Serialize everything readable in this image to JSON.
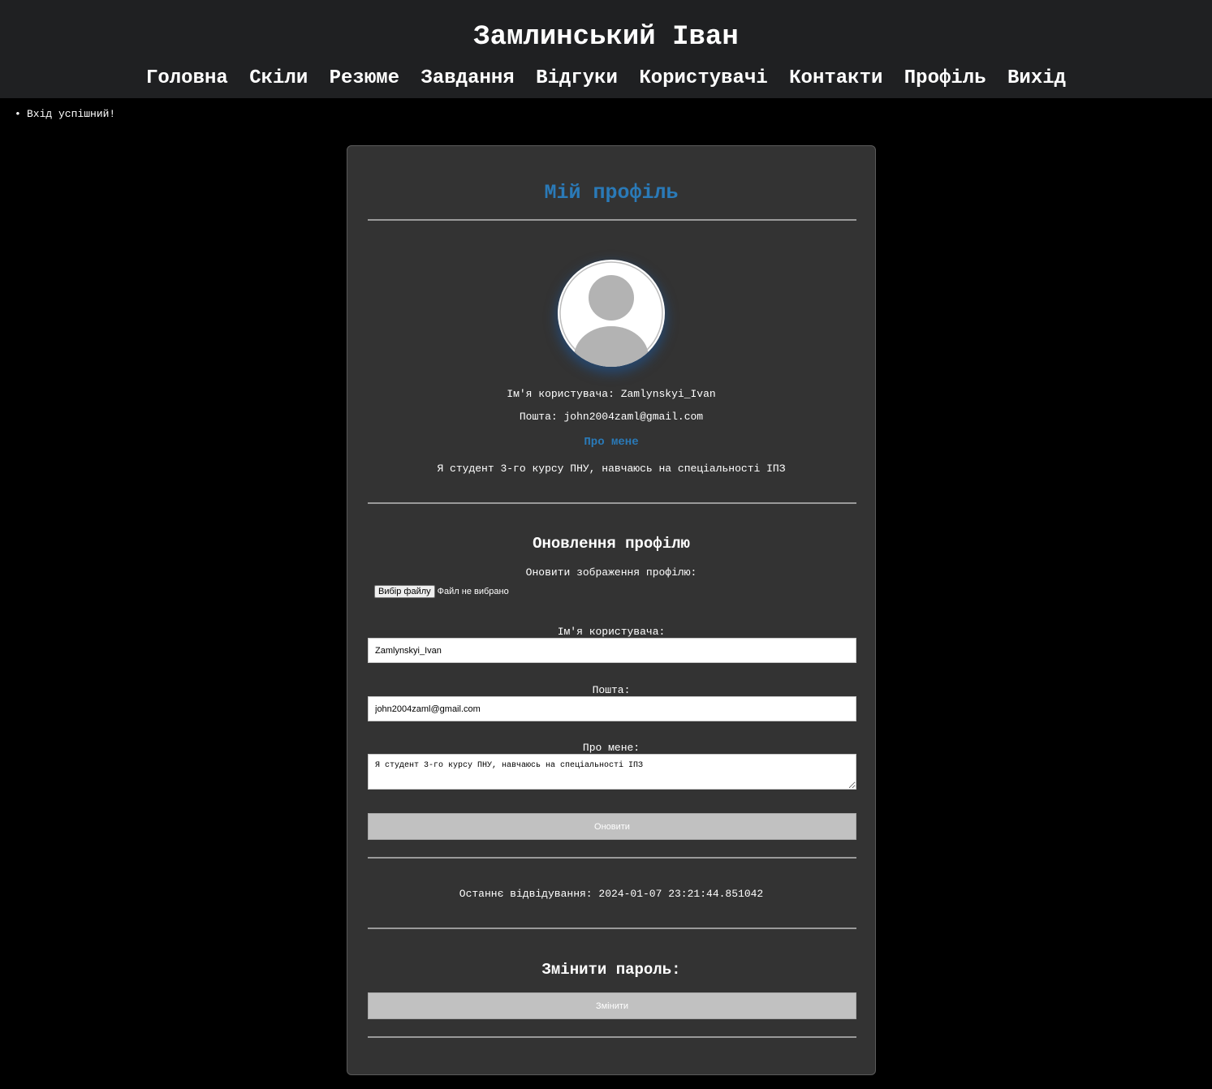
{
  "header": {
    "title": "Замлинський Іван",
    "nav": [
      "Головна",
      "Скіли",
      "Резюме",
      "Завдання",
      "Відгуки",
      "Користувачі",
      "Контакти",
      "Профіль",
      "Вихід"
    ]
  },
  "messages": [
    "Вхід успішний!"
  ],
  "profile": {
    "title": "Мій профіль",
    "avatar_icon": "default-user-avatar",
    "username_line": "Ім'я користувача: Zamlynskyi_Ivan",
    "email_line": "Пошта: john2004zaml@gmail.com",
    "about_heading": "Про мене",
    "about_text": "Я студент 3-го курсу ПНУ, навчаюсь на спеціальності ІПЗ"
  },
  "update_form": {
    "heading": "Оновлення профілю",
    "image_label": "Оновити зображення профілю:",
    "file_button": "Вибір файлу",
    "file_status": "Файл не вибрано",
    "username_label": "Ім'я користувача:",
    "username_value": "Zamlynskyi_Ivan",
    "email_label": "Пошта:",
    "email_value": "john2004zaml@gmail.com",
    "about_label": "Про мене:",
    "about_value": "Я студент 3-го курсу ПНУ, навчаюсь на спеціальності ІПЗ",
    "submit_label": "Оновити"
  },
  "last_visit": "Останнє відвідування: 2024-01-07 23:21:44.851042",
  "password": {
    "heading": "Змінити пароль:",
    "button_label": "Змінити"
  },
  "colors": {
    "accent": "#2a7ab8",
    "page_bg": "#000000",
    "header_bg": "#1f2022",
    "card_bg": "#333333",
    "button_bg": "#c1c1c1"
  }
}
